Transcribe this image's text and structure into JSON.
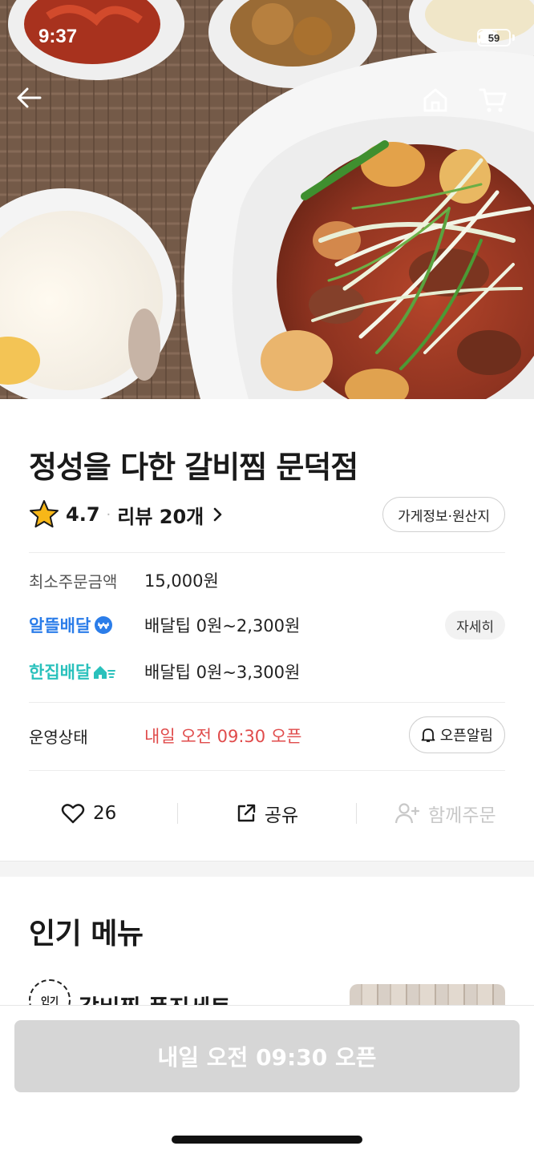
{
  "status_bar": {
    "time": "9:37",
    "battery": "59"
  },
  "hero": {
    "photo_subject": "braised galbi jjim with green onions in white bowl"
  },
  "store": {
    "name": "정성을 다한 갈비찜 문덕점",
    "rating": "4.7",
    "review_label": "리뷰 20개",
    "info_button": "가게정보·원산지"
  },
  "order_info": {
    "min_order_label": "최소주문금액",
    "min_order_value": "15,000원",
    "delivery_options": [
      {
        "brand": "알뜰배달",
        "tip": "배달팁 0원~2,300원",
        "action": "자세히",
        "color": "#2b7de9"
      },
      {
        "brand": "한집배달",
        "tip": "배달팁 0원~3,300원",
        "color": "#2ac1bc"
      }
    ],
    "status_label": "운영상태",
    "status_value": "내일 오전 09:30 오픈",
    "open_alarm": "오픈알림"
  },
  "actions": {
    "like_count": "26",
    "share": "공유",
    "group_order": "함께주문"
  },
  "popular": {
    "title": "인기 메뉴",
    "badge": "인기",
    "first_item": "갈비찜 풍진세트"
  },
  "bottom": {
    "cta": "내일 오전 09:30 오픈"
  },
  "colors": {
    "accent_red": "#e04b4b",
    "cta_disabled": "#d6d6d6"
  }
}
